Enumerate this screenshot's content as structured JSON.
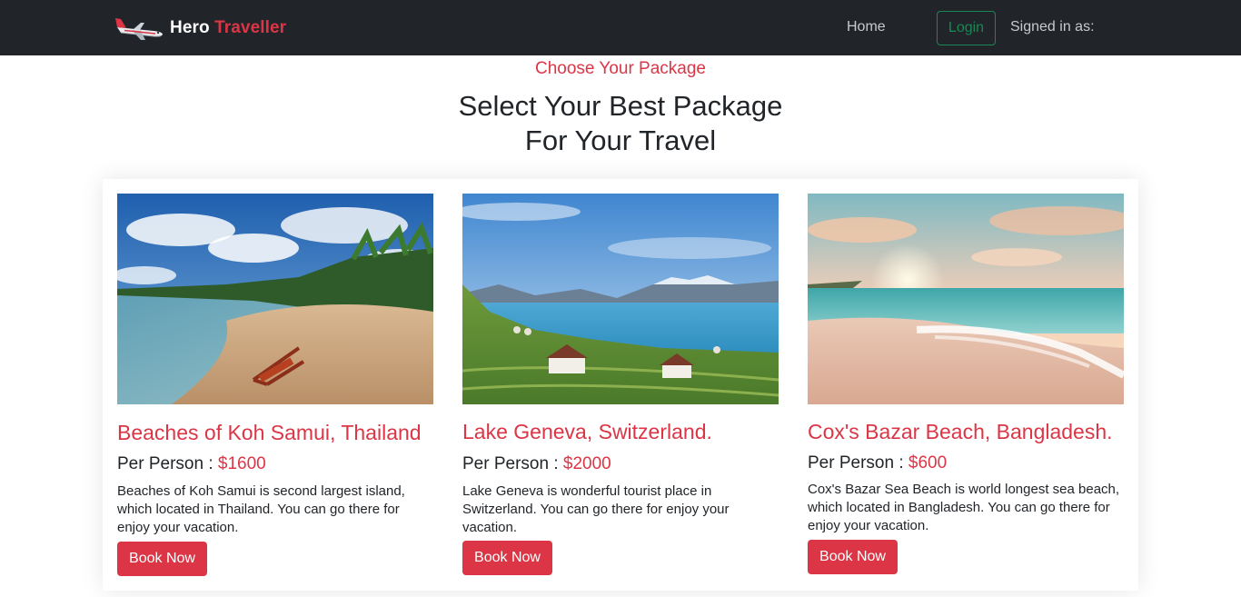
{
  "navbar": {
    "brand_first": "Hero",
    "brand_second": "Traveller",
    "logo_icon": "airplane-icon",
    "home_label": "Home",
    "login_label": "Login",
    "signed_in_label": "Signed in as:"
  },
  "section": {
    "eyebrow": "Choose Your Package",
    "title_line1": "Select Your Best Package",
    "title_line2": "For Your Travel"
  },
  "packages": [
    {
      "title": "Beaches of Koh Samui, Thailand",
      "price_label": "Per Person :",
      "price": "$1600",
      "description": "Beaches of Koh Samui is second largest island, which located in Thailand. You can go there for enjoy your vacation.",
      "button": "Book Now"
    },
    {
      "title": "Lake Geneva, Switzerland.",
      "price_label": "Per Person :",
      "price": "$2000",
      "description": "Lake Geneva is wonderful tourist place in Switzerland. You can go there for enjoy your vacation.",
      "button": "Book Now"
    },
    {
      "title": "Cox's Bazar Beach, Bangladesh.",
      "price_label": "Per Person :",
      "price": "$600",
      "description": "Cox's Bazar Sea Beach is world longest sea beach, which located in Bangladesh. You can go there for enjoy your vacation.",
      "button": "Book Now"
    }
  ],
  "colors": {
    "navbar_bg": "#212529",
    "accent_red": "#dc3545",
    "login_green": "#198754"
  }
}
